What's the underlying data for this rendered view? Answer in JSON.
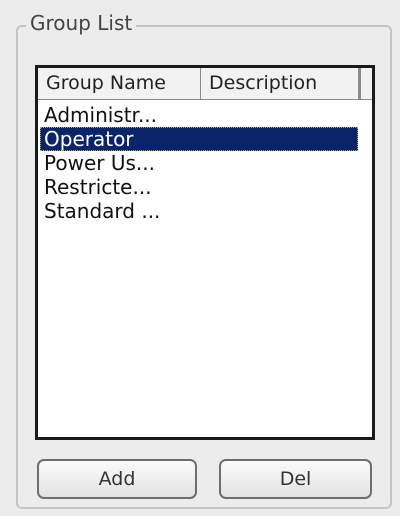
{
  "group_box": {
    "title": "Group List"
  },
  "list": {
    "columns": [
      "Group Name",
      "Description"
    ],
    "rows": [
      {
        "name": "Administr...",
        "description": "",
        "selected": false
      },
      {
        "name": "Operator",
        "description": "",
        "selected": true
      },
      {
        "name": "Power Us...",
        "description": "",
        "selected": false
      },
      {
        "name": "Restricte...",
        "description": "",
        "selected": false
      },
      {
        "name": "Standard ...",
        "description": "",
        "selected": false
      }
    ]
  },
  "buttons": {
    "add_label": "Add",
    "del_label": "Del"
  },
  "colors": {
    "selection": "#0a246a",
    "panel_background": "#ececec"
  }
}
